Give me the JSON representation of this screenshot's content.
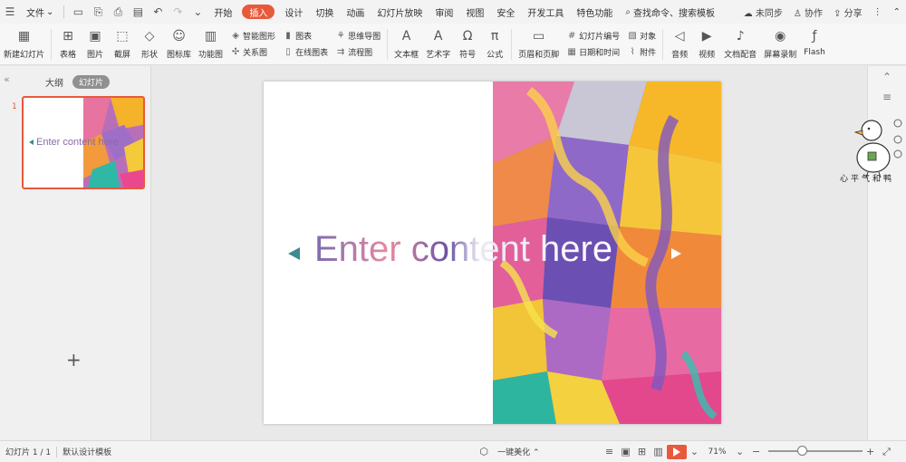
{
  "menubar": {
    "file": "文件",
    "tabs": [
      "开始",
      "插入",
      "设计",
      "切换",
      "动画",
      "幻灯片放映",
      "审阅",
      "视图",
      "安全",
      "开发工具",
      "特色功能"
    ],
    "active_tab": "插入",
    "search": "查找命令、搜索模板",
    "sync": "未同步",
    "collab": "协作",
    "share": "分享"
  },
  "ribbon": {
    "new_slide": "新建幻灯片",
    "table": "表格",
    "picture": "图片",
    "screenshot": "截屏",
    "shape": "形状",
    "icon_lib": "图标库",
    "func_chart": "功能图",
    "smart_art": "智能图形",
    "relation": "关系图",
    "chart": "图表",
    "online_chart": "在线图表",
    "mind_map": "思维导图",
    "flow_chart": "流程图",
    "textbox": "文本框",
    "art_text": "艺术字",
    "symbol": "符号",
    "formula": "公式",
    "header_footer": "页眉和页脚",
    "slide_number": "幻灯片编号",
    "date_time": "日期和时间",
    "object": "对象",
    "attachment": "附件",
    "audio": "音频",
    "video": "视频",
    "doc_dub": "文档配音",
    "screen_record": "屏幕录制",
    "flash": "Flash"
  },
  "leftpane": {
    "tab_outline": "大纲",
    "tab_slides": "幻灯片",
    "slide_num": "1",
    "thumb_text": "Enter content here"
  },
  "slide": {
    "title": "Enter content here"
  },
  "mascot_caption": "心平气和鸭",
  "statusbar": {
    "slide_info": "幻灯片 1 / 1",
    "template": "默认设计模板",
    "beautify": "一键美化",
    "zoom": "71%"
  },
  "colors": {
    "accent": "#e8593c",
    "arrow_teal": "#3c8b8e"
  }
}
